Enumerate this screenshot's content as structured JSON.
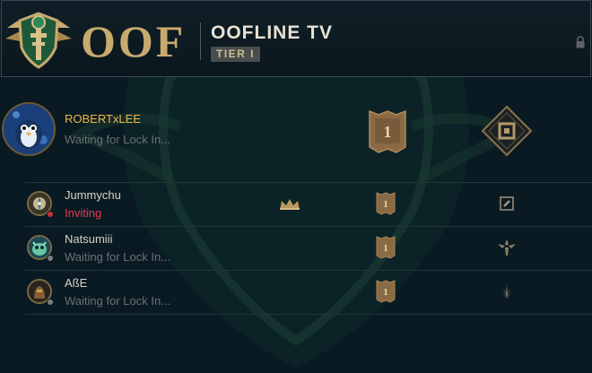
{
  "header": {
    "team_tag": "OOF",
    "team_name": "OOFLINE TV",
    "tier": "TIER I"
  },
  "captain": {
    "name": "ROBERTxLEE",
    "status": "Waiting for Lock In...",
    "tier_numeral": "1"
  },
  "members": [
    {
      "name": "Jummychu",
      "status": "Inviting",
      "tier_numeral": "1",
      "role": "mid",
      "status_color": "#e8384f",
      "dot_color": "#c8302f"
    },
    {
      "name": "Natsumiii",
      "status": "Waiting for Lock In...",
      "tier_numeral": "1",
      "role": "support",
      "status_color": "#6a7175",
      "dot_color": "#7c7f80"
    },
    {
      "name": "AßE",
      "status": "Waiting for Lock In...",
      "tier_numeral": "1",
      "role": "jungle",
      "status_color": "#6a7175",
      "dot_color": "#7c7f80"
    }
  ],
  "colors": {
    "gold": "#c8aa6e",
    "captain_name": "#f0b64a",
    "inviting": "#e8384f",
    "background": "#0a1a22"
  }
}
